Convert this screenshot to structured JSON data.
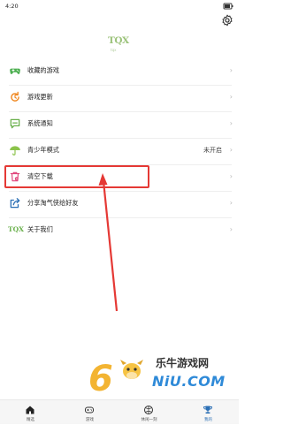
{
  "status_bar": {
    "time": "4:20"
  },
  "logo": {
    "text": "TQX",
    "subtext": "tqx"
  },
  "menu": [
    {
      "label": "收藏的游戏",
      "icon": "gamepad-icon",
      "value": ""
    },
    {
      "label": "游戏更新",
      "icon": "refresh-icon",
      "value": ""
    },
    {
      "label": "系统通知",
      "icon": "message-icon",
      "value": ""
    },
    {
      "label": "青少年模式",
      "icon": "umbrella-icon",
      "value": "未开启"
    },
    {
      "label": "清空下载",
      "icon": "trash-icon",
      "value": ""
    },
    {
      "label": "分享淘气侠给好友",
      "icon": "share-icon",
      "value": ""
    },
    {
      "label": "关于我们",
      "icon": "tqx-icon",
      "value": ""
    }
  ],
  "watermark": {
    "digit": "6",
    "title": "乐牛游戏网",
    "url": "NiU.COM"
  },
  "tabs": [
    {
      "label": "精选",
      "icon": "home-icon"
    },
    {
      "label": "游戏",
      "icon": "controller-icon"
    },
    {
      "label": "休闲一刻",
      "icon": "ball-icon"
    },
    {
      "label": "我的",
      "icon": "trophy-icon"
    }
  ],
  "colors": {
    "accent": "#2b6fb5",
    "highlight": "#e53935",
    "green": "#6ab04c",
    "orange": "#f08a24"
  }
}
